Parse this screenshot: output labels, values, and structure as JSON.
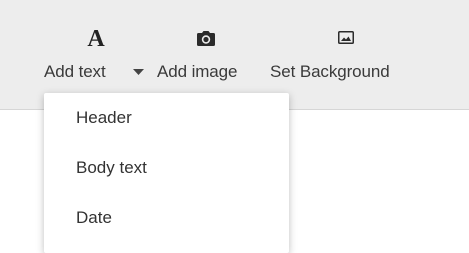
{
  "toolbar": {
    "add_text": {
      "label": "Add text",
      "icon": "letter-a-icon"
    },
    "add_image": {
      "label": "Add image",
      "icon": "camera-icon"
    },
    "set_background": {
      "label": "Set Background",
      "icon": "image-icon"
    }
  },
  "dropdown": {
    "items": [
      {
        "label": "Header"
      },
      {
        "label": "Body text"
      },
      {
        "label": "Date"
      }
    ]
  },
  "colors": {
    "toolbar_bg": "#ededed",
    "text": "#333333",
    "menu_bg": "#ffffff"
  }
}
